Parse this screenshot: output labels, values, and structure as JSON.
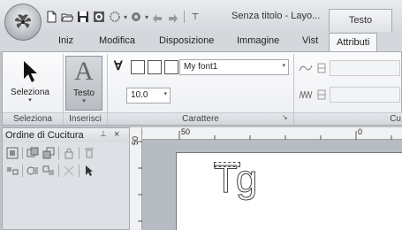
{
  "window": {
    "title": "Senza titolo - Layo...",
    "context_tab_header": "Testo"
  },
  "tabs": [
    {
      "label": "Iniz"
    },
    {
      "label": "Modifica"
    },
    {
      "label": "Disposizione"
    },
    {
      "label": "Immagine"
    },
    {
      "label": "Vist"
    },
    {
      "label": "Attributi",
      "active": true
    }
  ],
  "ribbon": {
    "select_button": "Seleziona",
    "text_button": "Testo",
    "font_name": "My font1",
    "font_size": "10.0",
    "groups": {
      "select": "Seleziona",
      "insert": "Inserisci",
      "chars": "Carattere",
      "partial": "Cu"
    }
  },
  "panel": {
    "title": "Ordine di Cucitura",
    "pin": "&#x4E4B;",
    "close": "×"
  },
  "ruler": {
    "unit": "mm",
    "h_label_a": "50",
    "h_label_b": "0",
    "v_label": "50"
  },
  "canvas": {
    "sample_text": "Tg"
  },
  "colors": {
    "accent_active": "#1a66c2",
    "ribbon_bg": "#f1f2f4",
    "workspace": "#b7bcc2"
  },
  "icons": [
    "app-menu-icon",
    "new-icon",
    "open-icon",
    "save-icon",
    "stitch-icon",
    "color-icon",
    "send-icon",
    "undo-icon",
    "redo-icon",
    "customize-icon",
    "select-arrow-icon",
    "text-a-icon",
    "font-type-icon",
    "dialog-launcher-icon",
    "wave-icon",
    "zigzag-icon"
  ]
}
